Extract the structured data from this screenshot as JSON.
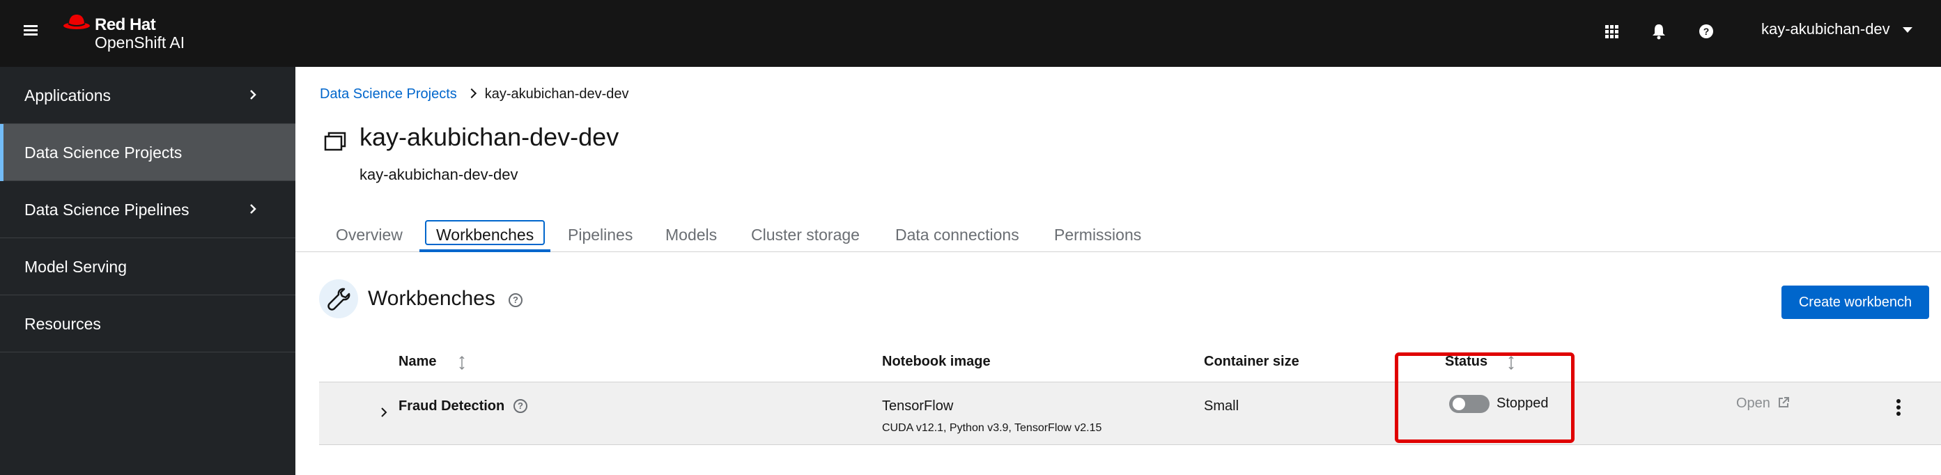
{
  "masthead": {
    "brand_line1": "Red Hat",
    "brand_line2": "OpenShift AI",
    "username": "kay-akubichan-dev",
    "icons": [
      "menu-icon",
      "app-launcher-icon",
      "notification-bell-icon",
      "help-icon",
      "caret-down-icon"
    ]
  },
  "sidebar": {
    "items": [
      {
        "label": "Applications",
        "expandable": true
      },
      {
        "label": "Data Science Projects",
        "active": true
      },
      {
        "label": "Data Science Pipelines",
        "expandable": true
      },
      {
        "label": "Model Serving"
      },
      {
        "label": "Resources"
      }
    ]
  },
  "breadcrumb": {
    "root": "Data Science Projects",
    "current": "kay-akubichan-dev-dev"
  },
  "project": {
    "title": "kay-akubichan-dev-dev",
    "subtitle": "kay-akubichan-dev-dev"
  },
  "tabs": [
    "Overview",
    "Workbenches",
    "Pipelines",
    "Models",
    "Cluster storage",
    "Data connections",
    "Permissions"
  ],
  "active_tab": "Workbenches",
  "workbenches": {
    "title": "Workbenches",
    "create_label": "Create workbench",
    "columns": {
      "name": "Name",
      "image": "Notebook image",
      "size": "Container size",
      "status": "Status"
    },
    "rows": [
      {
        "name": "Fraud Detection",
        "image": "TensorFlow",
        "image_detail": "CUDA v12.1, Python v3.9, TensorFlow v2.15",
        "size": "Small",
        "status": "Stopped",
        "running": false,
        "open_label": "Open"
      }
    ]
  },
  "colors": {
    "masthead": "#151515",
    "sidebar": "#212427",
    "primary": "#0066cc",
    "annotation": "#e00000"
  }
}
